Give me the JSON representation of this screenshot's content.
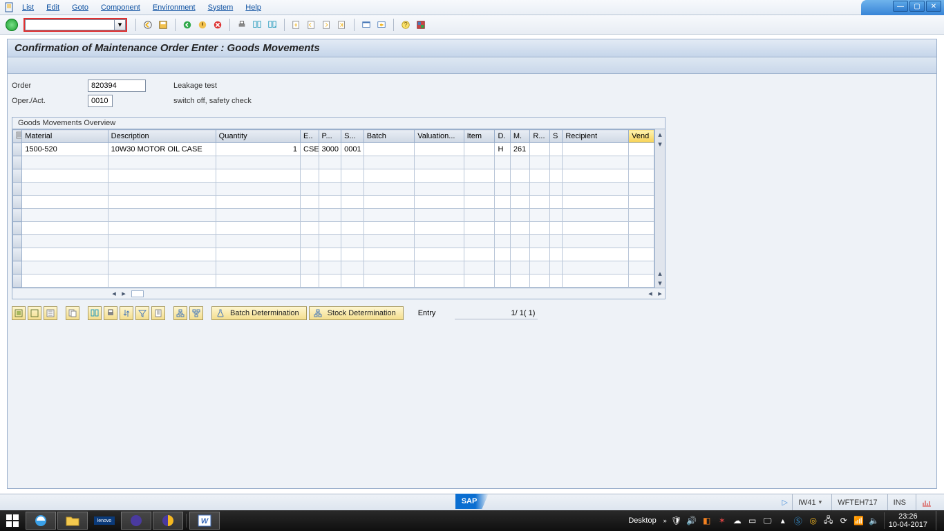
{
  "menu": {
    "items": [
      "List",
      "Edit",
      "Goto",
      "Component",
      "Environment",
      "System",
      "Help"
    ]
  },
  "command_input": "",
  "title": "Confirmation of Maintenance Order Enter : Goods Movements",
  "header": {
    "order_label": "Order",
    "order_value": "820394",
    "order_desc": "Leakage test",
    "operact_label": "Oper./Act.",
    "operact_value": "0010",
    "operact_desc": "switch off, safety check"
  },
  "group_title": "Goods Movements Overview",
  "columns": [
    "Material",
    "Description",
    "Quantity",
    "E..",
    "P...",
    "S...",
    "Batch",
    "Valuation...",
    "Item",
    "D.",
    "M.",
    "R...",
    "S",
    "Recipient",
    "Vend"
  ],
  "row": {
    "material": "1500-520",
    "description": "10W30 MOTOR OIL CASE",
    "quantity": "1",
    "e": "CSE",
    "p": "3000",
    "s": "0001",
    "batch": "",
    "valuation": "",
    "item": "",
    "d": "H",
    "m": "261",
    "r": "",
    "s2": "",
    "recipient": "",
    "vend": ""
  },
  "buttons": {
    "batch": "Batch Determination",
    "stock": "Stock Determination"
  },
  "entry": {
    "label": "Entry",
    "value": "1/ 1( 1)"
  },
  "status": {
    "tcode": "IW41",
    "server": "WFTEH717",
    "mode": "INS"
  },
  "taskbar": {
    "desktop": "Desktop",
    "time": "23:26",
    "date": "10-04-2017"
  }
}
